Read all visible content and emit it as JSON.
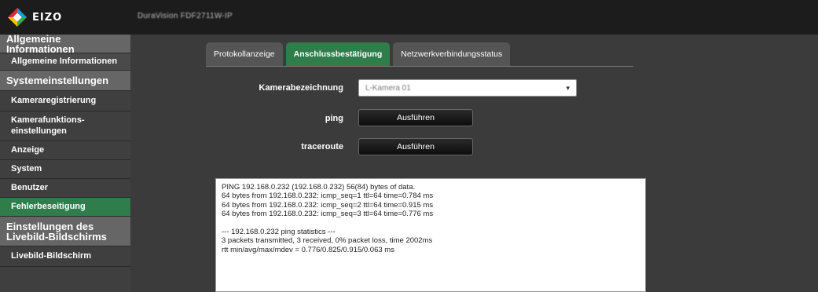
{
  "header": {
    "logo_text": "EIZO",
    "device_name": "DuraVision FDF2711W-IP"
  },
  "sidebar": {
    "sections": [
      {
        "title": "Allgemeine Informationen",
        "items": [
          "Allgemeine Informationen"
        ]
      },
      {
        "title": "Systemeinstellungen",
        "items": [
          "Kameraregistrierung",
          "Kamerafunktions-\neinstellungen",
          "Anzeige",
          "System",
          "Benutzer",
          "Fehlerbeseitigung"
        ]
      },
      {
        "title": "Einstellungen des Livebild-Bildschirms",
        "items": [
          "Livebild-Bildschirm"
        ]
      }
    ],
    "active_item": "Fehlerbeseitigung"
  },
  "tabs": [
    {
      "label": "Protokollanzeige"
    },
    {
      "label": "Anschlussbestätigung",
      "active": true
    },
    {
      "label": "Netzwerkverbindungsstatus"
    }
  ],
  "form": {
    "camera_label": "Kamerabezeichnung",
    "camera_value": "L-Kamera 01",
    "ping_label": "ping",
    "ping_button": "Ausführen",
    "traceroute_label": "traceroute",
    "traceroute_button": "Ausführen"
  },
  "output": {
    "lines": [
      "PING 192.168.0.232 (192.168.0.232) 56(84) bytes of data.",
      "64 bytes from 192.168.0.232: icmp_seq=1 ttl=64 time=0.784 ms",
      "64 bytes from 192.168.0.232: icmp_seq=2 ttl=64 time=0.915 ms",
      "64 bytes from 192.168.0.232: icmp_seq=3 ttl=64 time=0.776 ms",
      "",
      "--- 192.168.0.232 ping statistics ---",
      "3 packets transmitted, 3 received, 0% packet loss, time 2002ms",
      "rtt min/avg/max/mdev = 0.776/0.825/0.915/0.063 ms"
    ]
  },
  "colors": {
    "accent_green": "#2e7d4a",
    "header_bg": "#1c1c1c",
    "sidebar_section_bg": "#666666",
    "sidebar_item_bg": "#3f3f3f"
  }
}
